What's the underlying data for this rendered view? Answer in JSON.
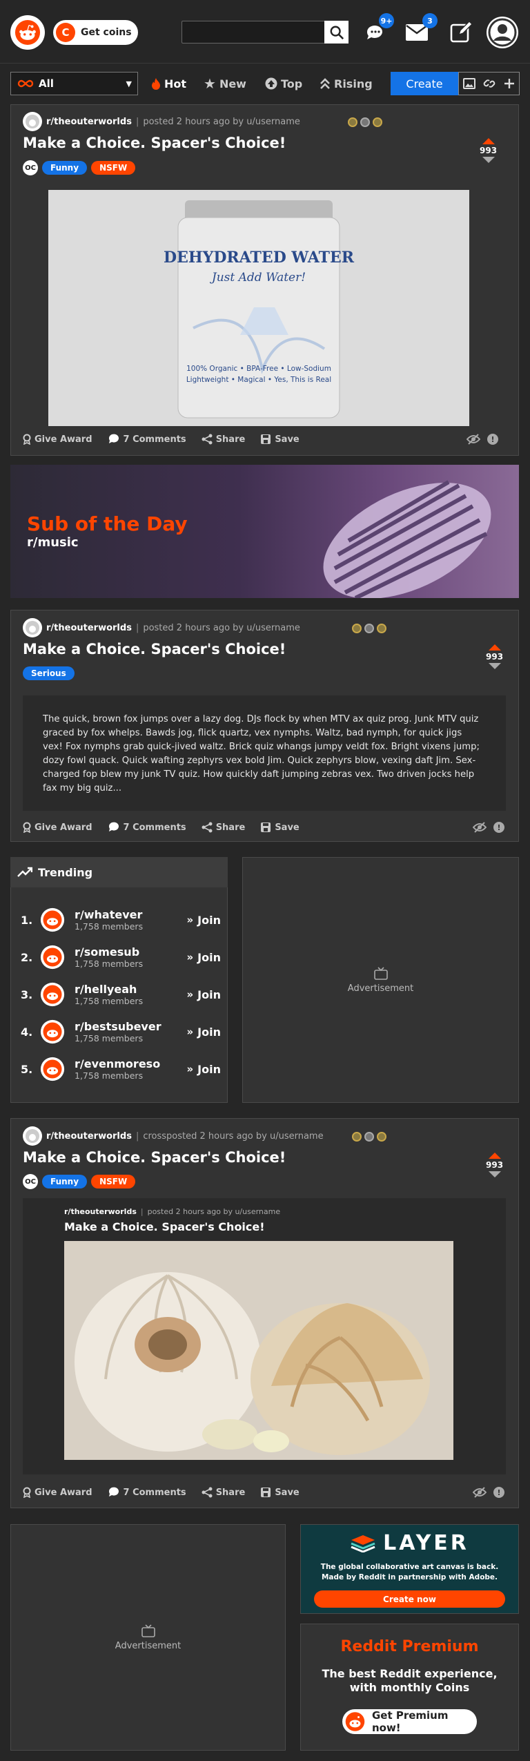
{
  "header": {
    "coins_label": "Get coins",
    "coins_icon": "C",
    "search": {
      "placeholder": "",
      "value": ""
    },
    "chat_badge": "9+",
    "mail_badge": "3"
  },
  "toolbar": {
    "feed": "All",
    "sorts": {
      "hot": "Hot",
      "new": "New",
      "top": "Top",
      "rising": "Rising"
    },
    "create": "Create"
  },
  "posts": [
    {
      "subreddit": "r/theouterworlds",
      "meta": "posted 2 hours ago by u/username",
      "title": "Make a Choice. Spacer's Choice!",
      "oc": "OC",
      "flairs": [
        "Funny",
        "NSFW"
      ],
      "votes": "993",
      "can_label_line1": "DEHYDRATED WATER",
      "can_label_line2": "Just Add Water!",
      "can_label_line3": "100% Organic • BPA-Free • Low-Sodium",
      "can_label_line4": "Lightweight • Magical • Yes, This is Real",
      "actions": {
        "award": "Give Award",
        "comments": "7 Comments",
        "share": "Share",
        "save": "Save"
      }
    },
    {
      "subreddit": "r/theouterworlds",
      "meta": "posted 2 hours ago by u/username",
      "title": "Make a Choice. Spacer's Choice!",
      "flairs": [
        "Serious"
      ],
      "votes": "993",
      "body": "The quick, brown fox jumps over a lazy dog. DJs flock by when MTV ax quiz prog. Junk MTV quiz graced by fox whelps. Bawds jog, flick quartz, vex nymphs. Waltz, bad nymph, for quick jigs vex! Fox nymphs grab quick-jived waltz. Brick quiz whangs jumpy veldt fox. Bright vixens jump; dozy fowl quack. Quick wafting zephyrs vex bold Jim. Quick zephyrs blow, vexing daft Jim. Sex-charged fop blew my junk TV quiz. How quickly daft jumping zebras vex. Two driven jocks help fax my big quiz...",
      "actions": {
        "award": "Give Award",
        "comments": "7 Comments",
        "share": "Share",
        "save": "Save"
      }
    },
    {
      "subreddit": "r/theouterworlds",
      "meta": "crossposted 2 hours ago by u/username",
      "title": "Make a Choice. Spacer's Choice!",
      "oc": "OC",
      "flairs": [
        "Funny",
        "NSFW"
      ],
      "votes": "993",
      "inner": {
        "subreddit": "r/theouterworlds",
        "meta": "posted 2 hours ago by u/username",
        "title": "Make a Choice. Spacer's Choice!"
      },
      "actions": {
        "award": "Give Award",
        "comments": "7 Comments",
        "share": "Share",
        "save": "Save"
      }
    }
  ],
  "sotd": {
    "title": "Sub of the Day",
    "sub": "r/music"
  },
  "trending": {
    "title": "Trending",
    "join": "Join",
    "items": [
      {
        "num": "1.",
        "name": "r/whatever",
        "members": "1,758 members"
      },
      {
        "num": "2.",
        "name": "r/somesub",
        "members": "1,758 members"
      },
      {
        "num": "3.",
        "name": "r/hellyeah",
        "members": "1,758 members"
      },
      {
        "num": "4.",
        "name": "r/bestsubever",
        "members": "1,758 members"
      },
      {
        "num": "5.",
        "name": "r/evenmoreso",
        "members": "1,758 members"
      }
    ]
  },
  "ads": {
    "label": "Advertisement"
  },
  "layer": {
    "brand": "LAYER",
    "line1": "The global collaborative art canvas is back.",
    "line2": "Made by Reddit in partnership with Adobe.",
    "cta": "Create now"
  },
  "premium": {
    "title": "Reddit Premium",
    "desc1": "The best Reddit experience,",
    "desc2": "with monthly Coins",
    "cta": "Get Premium now!"
  },
  "colors": {
    "accent": "#ff4500",
    "blue": "#1473e6",
    "bg": "#262626",
    "card": "#333333"
  }
}
